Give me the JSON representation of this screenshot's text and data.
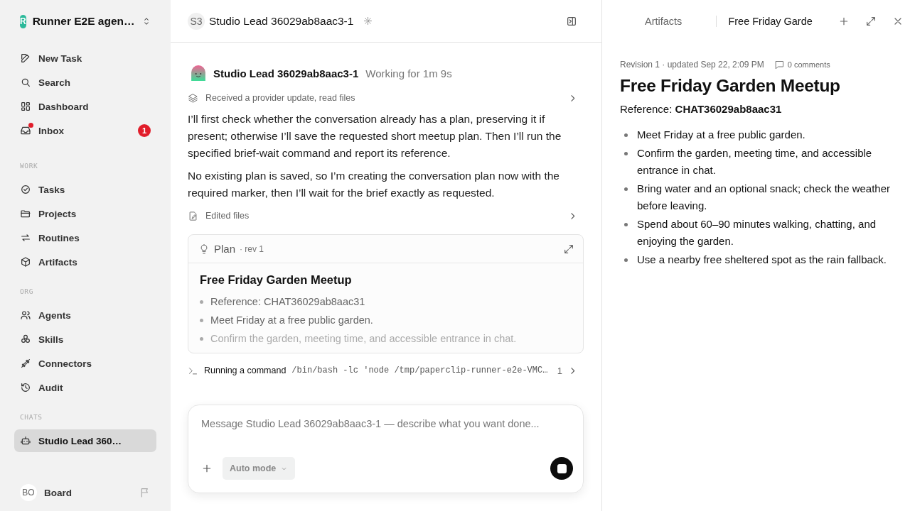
{
  "sidebar": {
    "workspace": {
      "initial": "R",
      "name": "Runner E2E agen…"
    },
    "sections": [
      {
        "items": [
          {
            "label": "New Task",
            "selected": false,
            "unread": false
          },
          {
            "label": "Search",
            "selected": false,
            "unread": false
          },
          {
            "label": "Dashboard",
            "selected": false,
            "unread": false
          },
          {
            "label": "Inbox",
            "selected": false,
            "unread": true,
            "badge": "1"
          }
        ]
      },
      {
        "heading": "WORK",
        "items": [
          {
            "label": "Tasks",
            "selected": false,
            "unread": false
          },
          {
            "label": "Projects",
            "selected": false,
            "unread": false
          },
          {
            "label": "Routines",
            "selected": false,
            "unread": false
          },
          {
            "label": "Artifacts",
            "selected": false,
            "unread": false
          }
        ]
      },
      {
        "heading": "ORG",
        "items": [
          {
            "label": "Agents",
            "selected": false,
            "unread": false
          },
          {
            "label": "Skills",
            "selected": false,
            "unread": false
          },
          {
            "label": "Connectors",
            "selected": false,
            "unread": false
          },
          {
            "label": "Audit",
            "selected": false,
            "unread": false
          }
        ]
      },
      {
        "heading": "CHATS",
        "items": [
          {
            "label": "Studio Lead 360…",
            "selected": true,
            "unread": false
          }
        ]
      }
    ],
    "user": {
      "initials": "BO",
      "name": "Board"
    }
  },
  "chat_header": {
    "initials": "S3",
    "title": "Studio Lead 36029ab8aac3-1"
  },
  "message": {
    "author": "Studio Lead 36029ab8aac3-1",
    "status": "Working for 1m 9s",
    "blocks": [
      {
        "kind": "activity",
        "text": "Received a provider update, read files"
      },
      {
        "kind": "paragraph",
        "text": "I’ll first check whether the conversation already has a plan, preserving it if present; otherwise I’ll save the requested short meetup plan. Then I’ll run the specified brief-wait command and report its reference."
      },
      {
        "kind": "paragraph",
        "text": "No existing plan is saved, so I’m creating the conversation plan now with the required marker, then I’ll wait for the brief exactly as requested."
      },
      {
        "kind": "activity",
        "text": "Edited files"
      },
      {
        "kind": "plan",
        "label": "Plan",
        "revision": "· rev 1",
        "title": "Free Friday Garden Meetup",
        "items": [
          "Reference: CHAT36029ab8aac31",
          "Meet Friday at a free public garden.",
          "Confirm the garden, meeting time, and accessible entrance in chat."
        ]
      },
      {
        "kind": "command",
        "label": "Running a command",
        "command": "/bin/bash -lc 'node /tmp/paperclip-runner-e2e-VMC…",
        "count": "1"
      }
    ]
  },
  "composer": {
    "placeholder": "Message Studio Lead 36029ab8aac3-1 — describe what you want done...",
    "mode": "Auto mode"
  },
  "artifact_panel": {
    "tabs": [
      {
        "label": "Artifacts",
        "selected": false
      },
      {
        "label": "Free Friday Garde",
        "selected": true
      }
    ],
    "meta": "Revision 1 · updated Sep 22, 2:09 PM",
    "comments": "0 comments",
    "title": "Free Friday Garden Meetup",
    "reference": "Reference: **CHAT36029ab8aac31**",
    "items": [
      "Meet Friday at a free public garden.",
      "Confirm the garden, meeting time, and accessible entrance in chat.",
      "Bring water and an optional snack; check the weather before leaving.",
      "Spend about 60–90 minutes walking, chatting, and enjoying the garden.",
      "Use a nearby free sheltered spot as the rain fallback."
    ]
  }
}
